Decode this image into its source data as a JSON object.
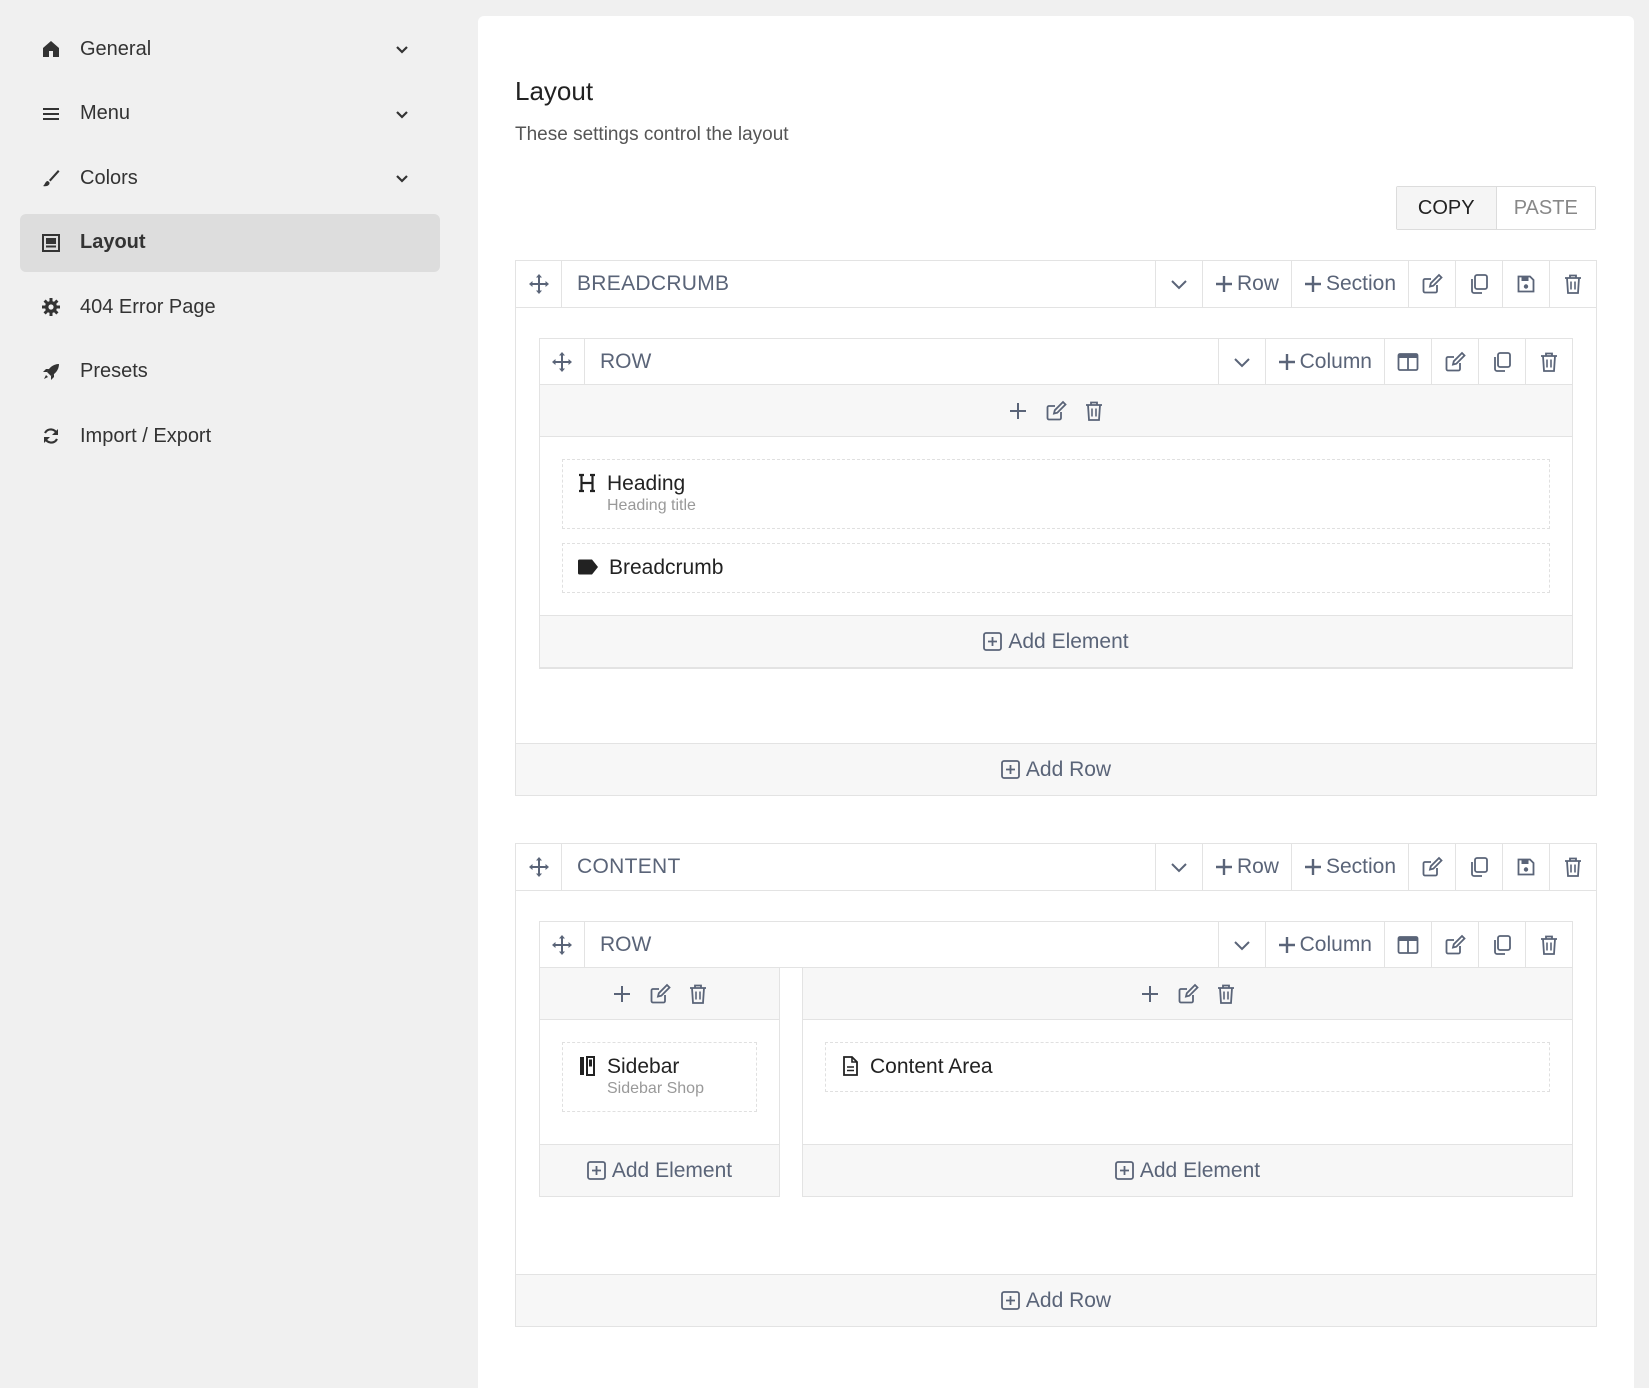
{
  "sidebar": {
    "items": [
      {
        "label": "General",
        "icon": "home-icon",
        "expandable": true
      },
      {
        "label": "Menu",
        "icon": "menu-icon",
        "expandable": true
      },
      {
        "label": "Colors",
        "icon": "brush-icon",
        "expandable": true
      },
      {
        "label": "Layout",
        "icon": "layout-icon",
        "active": true
      },
      {
        "label": "404 Error Page",
        "icon": "gear-icon"
      },
      {
        "label": "Presets",
        "icon": "rocket-icon"
      },
      {
        "label": "Import / Export",
        "icon": "sync-icon"
      }
    ]
  },
  "main": {
    "title": "Layout",
    "description": "These settings control the layout",
    "copy_label": "COPY",
    "paste_label": "PASTE"
  },
  "toolbar": {
    "row_label": "Row",
    "section_label": "Section",
    "column_label": "Column",
    "add_element_label": "Add Element",
    "add_row_label": "Add Row"
  },
  "sections": [
    {
      "title": "BREADCRUMB",
      "row": {
        "title": "ROW",
        "columns": [
          {
            "elements": [
              {
                "name": "Heading",
                "subtitle": "Heading title",
                "icon": "heading-icon"
              },
              {
                "name": "Breadcrumb",
                "icon": "tag-icon"
              }
            ]
          }
        ]
      }
    },
    {
      "title": "CONTENT",
      "row": {
        "title": "ROW",
        "columns": [
          {
            "elements": [
              {
                "name": "Sidebar",
                "subtitle": "Sidebar Shop",
                "icon": "sidebar-icon"
              }
            ]
          },
          {
            "elements": [
              {
                "name": "Content Area",
                "icon": "file-icon"
              }
            ]
          }
        ]
      }
    }
  ],
  "colors": {
    "panel_bg": "#ffffff",
    "page_bg": "#f0f0f0",
    "active_nav_bg": "#dddddd",
    "toolbar_text": "#5a6478",
    "border": "#e3e3e3"
  }
}
